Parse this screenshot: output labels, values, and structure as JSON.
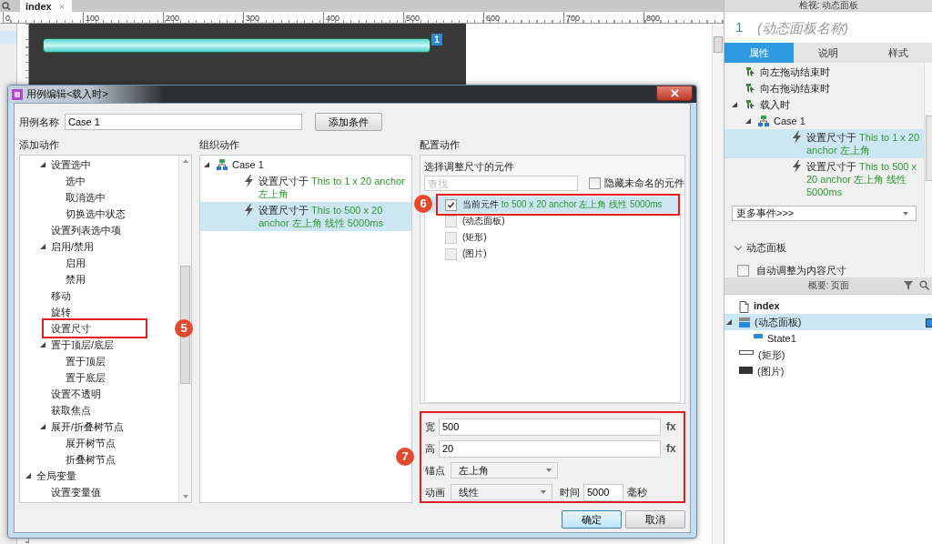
{
  "editor_tab": {
    "label": "index",
    "close": "×",
    "selected": true
  },
  "ruler": {
    "ticks": [
      "0",
      "100",
      "200",
      "300",
      "400",
      "500",
      "600",
      "700",
      "800"
    ]
  },
  "canvas": {
    "widget_number": "1"
  },
  "dialog": {
    "title": "用例编辑<载入时>",
    "case_name": {
      "label": "用例名称",
      "value": "Case 1"
    },
    "add_condition_button": "添加条件",
    "add_action": {
      "heading": "添加动作",
      "tree": [
        {
          "children": [
            {
              "label": "设置选中",
              "expanded": true,
              "children": [
                {
                  "label": "选中"
                },
                {
                  "label": "取消选中"
                },
                {
                  "label": "切换选中状态"
                }
              ]
            },
            {
              "label": "设置列表选中项"
            },
            {
              "label": "启用/禁用",
              "expanded": true,
              "children": [
                {
                  "label": "启用"
                },
                {
                  "label": "禁用"
                }
              ]
            },
            {
              "label": "移动"
            },
            {
              "label": "旋转"
            },
            {
              "label": "设置尺寸",
              "callout": "5"
            },
            {
              "label": "置于顶层/底层",
              "expanded": true,
              "children": [
                {
                  "label": "置于顶层"
                },
                {
                  "label": "置于底层"
                }
              ]
            },
            {
              "label": "设置不透明"
            },
            {
              "label": "获取焦点"
            },
            {
              "label": "展开/折叠树节点",
              "expanded": true,
              "children": [
                {
                  "label": "展开树节点"
                },
                {
                  "label": "折叠树节点"
                }
              ]
            }
          ]
        },
        {
          "label": "全局变量",
          "expanded": true,
          "children": [
            {
              "label": "设置变量值"
            }
          ]
        }
      ]
    },
    "organize_actions": {
      "heading": "组织动作",
      "tree": [
        {
          "kind": "case",
          "label": "Case 1",
          "expanded": true,
          "children": [
            {
              "kind": "action",
              "label": "设置尺寸于",
              "detail": "This to 1 x 20 anchor 左上角",
              "selected": false
            },
            {
              "kind": "action",
              "label": "设置尺寸于",
              "detail": "This to 500 x 20 anchor 左上角 线性 5000ms",
              "selected": true
            }
          ]
        }
      ]
    },
    "configure_action": {
      "heading": "配置动作",
      "group_label": "选择调整尺寸的元件",
      "search": {
        "placeholder": "查找"
      },
      "hide_unnamed": {
        "label": "隐藏未命名的元件",
        "checked": false
      },
      "widgets": [
        {
          "label": "当前元件",
          "detail": "to 500 x 20 anchor 左上角 线性 5000ms",
          "checked": true,
          "selected": true,
          "callout": "6"
        },
        {
          "label": "(动态面板)",
          "checked": false,
          "selected": false
        },
        {
          "label": "(矩形)",
          "checked": false,
          "selected": false
        },
        {
          "label": "(图片)",
          "checked": false,
          "selected": false
        }
      ],
      "settings": {
        "callout": "7",
        "width": {
          "label": "宽",
          "value": "500",
          "fx": "fx"
        },
        "height": {
          "label": "高",
          "value": "20",
          "fx": "fx"
        },
        "anchor": {
          "label": "锚点",
          "value": "左上角"
        },
        "animation": {
          "label": "动画",
          "value": "线性"
        },
        "duration": {
          "label": "时间",
          "value": "5000",
          "unit": "毫秒"
        }
      }
    },
    "buttons": [
      {
        "label": "确定",
        "kind": "primary"
      },
      {
        "label": "取消",
        "kind": "normal"
      }
    ]
  },
  "inspector": {
    "header": "检视: 动态面板",
    "widget_number": "1",
    "name": {
      "placeholder": "(动态面板名称)"
    },
    "tabs": [
      {
        "label": "属性",
        "selected": true
      },
      {
        "label": "说明",
        "selected": false
      },
      {
        "label": "样式",
        "selected": false
      }
    ],
    "events": [
      {
        "kind": "event",
        "label": "向左拖动结束时"
      },
      {
        "kind": "event",
        "label": "向右拖动结束时"
      },
      {
        "kind": "event",
        "label": "载入时",
        "expanded": true,
        "children": [
          {
            "kind": "case",
            "label": "Case 1",
            "expanded": true,
            "children": [
              {
                "kind": "action",
                "label": "设置尺寸于",
                "detail": "This to 1 x 20 anchor 左上角",
                "selected": true
              },
              {
                "kind": "action",
                "label": "设置尺寸于",
                "detail": "This to 500 x 20 anchor 左上角 线性 5000ms",
                "selected": false
              }
            ]
          }
        ]
      }
    ],
    "more_events": "更多事件>>>",
    "section": {
      "label": "动态面板",
      "expanded": true
    },
    "fit_to_content": {
      "label": "自动调整为内容尺寸",
      "checked": false
    }
  },
  "outline": {
    "header": "概要: 页面",
    "tree": [
      {
        "kind": "page",
        "label": "index"
      },
      {
        "kind": "panel",
        "label": "(动态面板)",
        "expanded": true,
        "selected": true,
        "children": [
          {
            "kind": "state",
            "label": "State1",
            "selected": false
          }
        ]
      },
      {
        "kind": "rectangle",
        "label": "(矩形)",
        "selected": false
      },
      {
        "kind": "image",
        "label": "(图片)",
        "selected": false
      }
    ]
  }
}
